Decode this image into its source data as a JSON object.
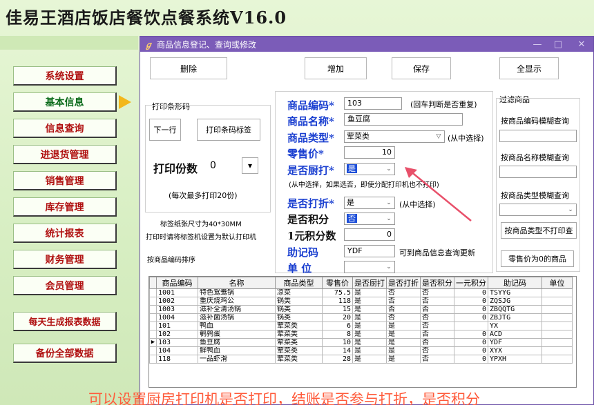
{
  "app_title": "佳易王酒店饭店餐饮点餐系统V16.0",
  "sidebar": {
    "items": [
      {
        "label": "系统设置"
      },
      {
        "label": "基本信息"
      },
      {
        "label": "信息查询"
      },
      {
        "label": "进退货管理"
      },
      {
        "label": "销售管理"
      },
      {
        "label": "库存管理"
      },
      {
        "label": "统计报表"
      },
      {
        "label": "财务管理"
      },
      {
        "label": "会员管理"
      },
      {
        "label": "每天生成报表数据"
      },
      {
        "label": "备份全部数据"
      }
    ]
  },
  "dialog": {
    "title": "商品信息登记、查询或修改",
    "window_controls": {
      "minimize": "—",
      "maximize": "□",
      "close": "✕"
    },
    "toolbar": {
      "delete_label": "删除",
      "add_label": "增加",
      "save_label": "保存",
      "show_all_label": "全显示"
    },
    "print_panel": {
      "title": "打印条形码",
      "next_row_label": "下一行",
      "print_label_button": "打印条码标签",
      "copies_label": "打印份数",
      "copies_value": "0",
      "max_note": "(每次最多打印20份)",
      "paper_note": "标签纸张尺寸为40*30MM",
      "printer_note": "打印时请将标签机设置为默认打印机",
      "sort_note": "按商品编码排序"
    },
    "form": {
      "code_label": "商品编码*",
      "code_value": "103",
      "code_hint": "(回车判断是否重复)",
      "name_label": "商品名称*",
      "name_value": "鱼豆腐",
      "type_label": "商品类型*",
      "type_value": "荤菜类",
      "type_hint": "(从中选择)",
      "price_label": "零售价*",
      "price_value": "10",
      "kitchen_label": "是否厨打*",
      "kitchen_value": "是",
      "kitchen_hint": "(从中选择，如果选否，即使分配打印机也不打印)",
      "discount_label": "是否打折*",
      "discount_value": "是",
      "discount_hint": "(从中选择)",
      "points_label": "是否积分",
      "points_value": "否",
      "points_per_yuan_label": "1元积分数",
      "points_per_yuan_value": "0",
      "mnemonic_label": "助记码",
      "mnemonic_value": "YDF",
      "mnemonic_hint": "可到商品信息查询更新",
      "unit_label": "单  位",
      "unit_value": ""
    },
    "filter_panel": {
      "title": "过滤商品",
      "by_code_label": "按商品编码模糊查询",
      "by_code_value": "",
      "by_name_label": "按商品名称模糊查询",
      "by_name_value": "",
      "by_type_label": "按商品类型模糊查询",
      "by_type_value": "",
      "type_no_print_button": "按商品类型不打印查",
      "zero_price_button": "零售价为0的商品"
    },
    "table": {
      "columns": [
        "商品编码",
        "名称",
        "商品类型",
        "零售价",
        "是否厨打",
        "是否打折",
        "是否积分",
        "一元积分",
        "助记码",
        "单位"
      ],
      "current_row_marker": "▶",
      "rows": [
        [
          "1001",
          "特色鸳鸯锅",
          "凉菜",
          "75.5",
          "是",
          "否",
          "否",
          "0",
          "TSYYG",
          ""
        ],
        [
          "1002",
          "重庆烧鸡公",
          "锅类",
          "118",
          "是",
          "否",
          "否",
          "0",
          "ZQSJG",
          ""
        ],
        [
          "1003",
          "滋补全清汤锅",
          "锅类",
          "15",
          "是",
          "否",
          "否",
          "0",
          "ZBQQTG",
          ""
        ],
        [
          "1004",
          "滋补菌汤锅",
          "锅类",
          "20",
          "是",
          "否",
          "否",
          "0",
          "ZBJTG",
          ""
        ],
        [
          "101",
          "鸭血",
          "荤菜类",
          "6",
          "是",
          "是",
          "否",
          "",
          "YX",
          ""
        ],
        [
          "102",
          "鹌鹑蛋",
          "荤菜类",
          "8",
          "是",
          "是",
          "否",
          "0",
          "ACD",
          ""
        ],
        [
          "103",
          "鱼豆腐",
          "荤菜类",
          "10",
          "是",
          "是",
          "否",
          "0",
          "YDF",
          ""
        ],
        [
          "104",
          "鲜鸭血",
          "荤菜类",
          "14",
          "是",
          "是",
          "否",
          "0",
          "XYX",
          ""
        ],
        [
          "118",
          "一品虾滑",
          "荤菜类",
          "28",
          "是",
          "是",
          "否",
          "0",
          "YPXH",
          ""
        ]
      ],
      "current_row_index": 6
    }
  },
  "caption": "可以设置厨房打印机是否打印，结账是否参与打折，是否积分",
  "colors": {
    "menu_text": "#b01010",
    "titlebar": "#7b5cb8",
    "form_label_blue": "#1a3fd0",
    "caption": "#ff5a3a",
    "arrow": "#e8506a"
  }
}
